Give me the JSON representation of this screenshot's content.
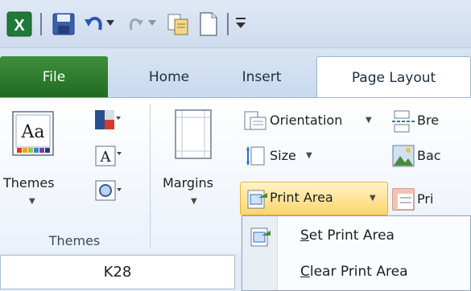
{
  "quick_access": {
    "icons": [
      "excel-icon",
      "save-icon",
      "undo-icon",
      "redo-icon",
      "copy-icon",
      "new-document-icon",
      "customize-icon"
    ]
  },
  "tabs": [
    {
      "label": "File"
    },
    {
      "label": "Home"
    },
    {
      "label": "Insert"
    },
    {
      "label": "Page Layout"
    }
  ],
  "ribbon": {
    "themes_group": {
      "themes_label": "Themes",
      "group_label": "Themes",
      "font_glyph": "A",
      "aa_glyph": "Aa"
    },
    "page_setup": {
      "margins_label": "Margins",
      "orientation_label": "Orientation",
      "size_label": "Size",
      "print_area_label": "Print Area",
      "breaks_label": "Bre",
      "background_label": "Bac",
      "print_titles_label": "Pri"
    }
  },
  "name_box": {
    "value": "K28"
  },
  "print_area_menu": {
    "items": [
      {
        "label": "Set Print Area",
        "accel": "S",
        "rest": "et Print Area"
      },
      {
        "label": "Clear Print Area",
        "accel": "C",
        "rest": "lear Print Area"
      }
    ]
  },
  "colors": {
    "file_tab": "#2e7d32",
    "highlight": "#ffd56a"
  }
}
